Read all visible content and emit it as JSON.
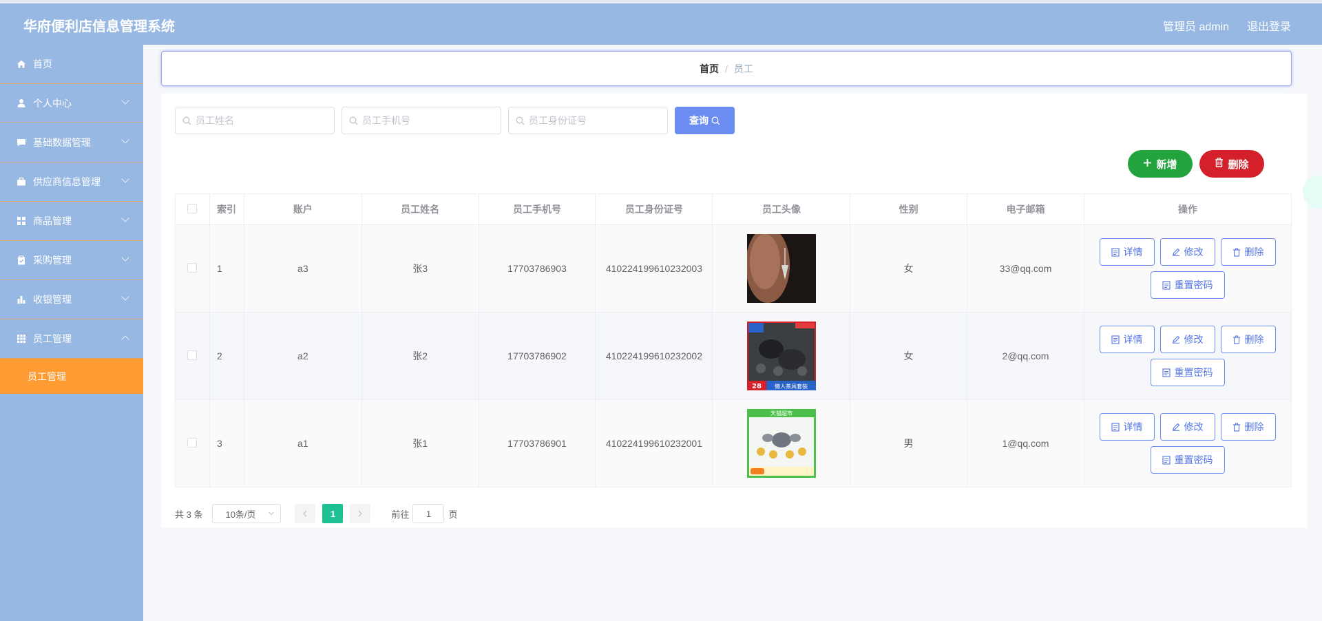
{
  "header": {
    "title": "华府便利店信息管理系统",
    "admin_label": "管理员 admin",
    "logout_label": "退出登录"
  },
  "sidebar": {
    "items": [
      {
        "label": "首页",
        "icon": "home-icon"
      },
      {
        "label": "个人中心",
        "icon": "user-icon"
      },
      {
        "label": "基础数据管理",
        "icon": "message-icon"
      },
      {
        "label": "供应商信息管理",
        "icon": "briefcase-icon"
      },
      {
        "label": "商品管理",
        "icon": "grid-icon"
      },
      {
        "label": "采购管理",
        "icon": "clipboard-icon"
      },
      {
        "label": "收银管理",
        "icon": "bar-chart-icon"
      },
      {
        "label": "员工管理",
        "icon": "menu-grid-icon"
      }
    ],
    "submenu": {
      "label": "员工管理"
    }
  },
  "breadcrumb": {
    "home": "首页",
    "separator": "/",
    "current": "员工"
  },
  "search": {
    "name_placeholder": "员工姓名",
    "phone_placeholder": "员工手机号",
    "idcard_placeholder": "员工身份证号",
    "query_label": "查询"
  },
  "actions": {
    "add_label": "新增",
    "delete_label": "删除"
  },
  "table": {
    "headers": [
      "索引",
      "账户",
      "员工姓名",
      "员工手机号",
      "员工身份证号",
      "员工头像",
      "性别",
      "电子邮箱",
      "操作"
    ],
    "rows": [
      {
        "index": "1",
        "account": "a3",
        "name": "张3",
        "phone": "17703786903",
        "idcard": "410224199610232003",
        "gender": "女",
        "email": "33@qq.com",
        "avatar_caption": "",
        "badge": ""
      },
      {
        "index": "2",
        "account": "a2",
        "name": "张2",
        "phone": "17703786902",
        "idcard": "410224199610232002",
        "gender": "女",
        "email": "2@qq.com",
        "avatar_caption": "懒人茶具套装",
        "badge": "28"
      },
      {
        "index": "3",
        "account": "a1",
        "name": "张1",
        "phone": "17703786901",
        "idcard": "410224199610232001",
        "gender": "男",
        "email": "1@qq.com",
        "avatar_caption": "天猫超市",
        "badge": ""
      }
    ],
    "op_labels": {
      "detail": "详情",
      "edit": "修改",
      "delete": "删除",
      "reset_password": "重置密码"
    }
  },
  "pagination": {
    "total_text": "共 3 条",
    "page_size": "10条/页",
    "current_page": "1",
    "goto_label": "前往",
    "goto_value": "1",
    "page_suffix": "页"
  },
  "colors": {
    "header_bg": "#97b8e2",
    "sidebar_bg": "#97b8e2",
    "active_menu": "#ff9b33",
    "primary": "#6b8cf0",
    "add": "#23a33e",
    "delete": "#d4202a",
    "page_active": "#1ec092"
  }
}
